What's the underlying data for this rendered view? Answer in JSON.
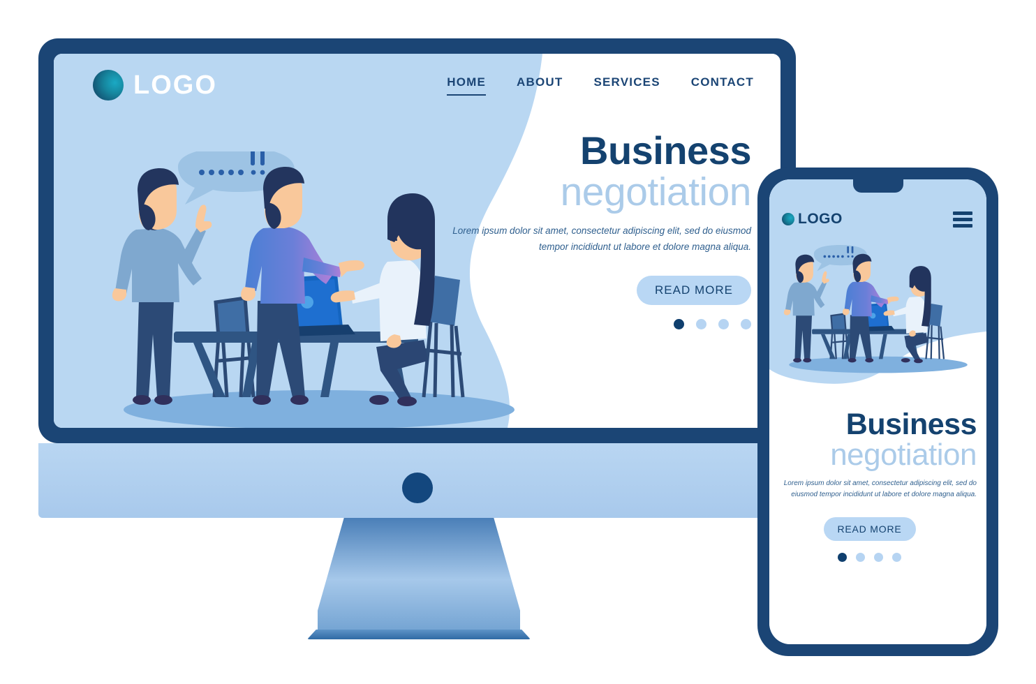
{
  "brand": {
    "logo_text": "LOGO",
    "logo_icon": "circle-gradient-icon",
    "accent_navy": "#14426f",
    "accent_light_blue": "#abcbe9",
    "screen_bg": "#bfdcf5",
    "bezel": "#1b4575"
  },
  "desktop": {
    "nav": [
      {
        "label": "HOME",
        "active": true
      },
      {
        "label": "ABOUT",
        "active": false
      },
      {
        "label": "SERVICES",
        "active": false
      },
      {
        "label": "CONTACT",
        "active": false
      }
    ],
    "hero": {
      "title_bold": "Business",
      "title_thin": "negotiation",
      "paragraph": "Lorem ipsum dolor sit amet, consectetur adipiscing elit, sed do eiusmod tempor incididunt ut labore et dolore magna aliqua.",
      "cta_label": "READ MORE",
      "carousel_dots": 4,
      "carousel_active_index": 0
    }
  },
  "phone": {
    "logo_text": "LOGO",
    "menu_icon": "hamburger-menu-icon",
    "hero": {
      "title_bold": "Business",
      "title_thin": "negotiation",
      "paragraph": "Lorem ipsum dolor sit amet, consectetur adipiscing elit, sed do eiusmod tempor incididunt ut labore et dolore magna aliqua.",
      "cta_label": "READ MORE",
      "carousel_dots": 4,
      "carousel_active_index": 0
    }
  },
  "illustration": {
    "scene": "business-negotiation-meeting",
    "speech_bubble_text": "!!",
    "characters": [
      "standing-man-pointing-up",
      "standing-man-gesturing",
      "seated-woman"
    ],
    "objects": [
      "desk",
      "laptop",
      "chair-empty",
      "chair-occupied",
      "floor-shadow"
    ]
  }
}
